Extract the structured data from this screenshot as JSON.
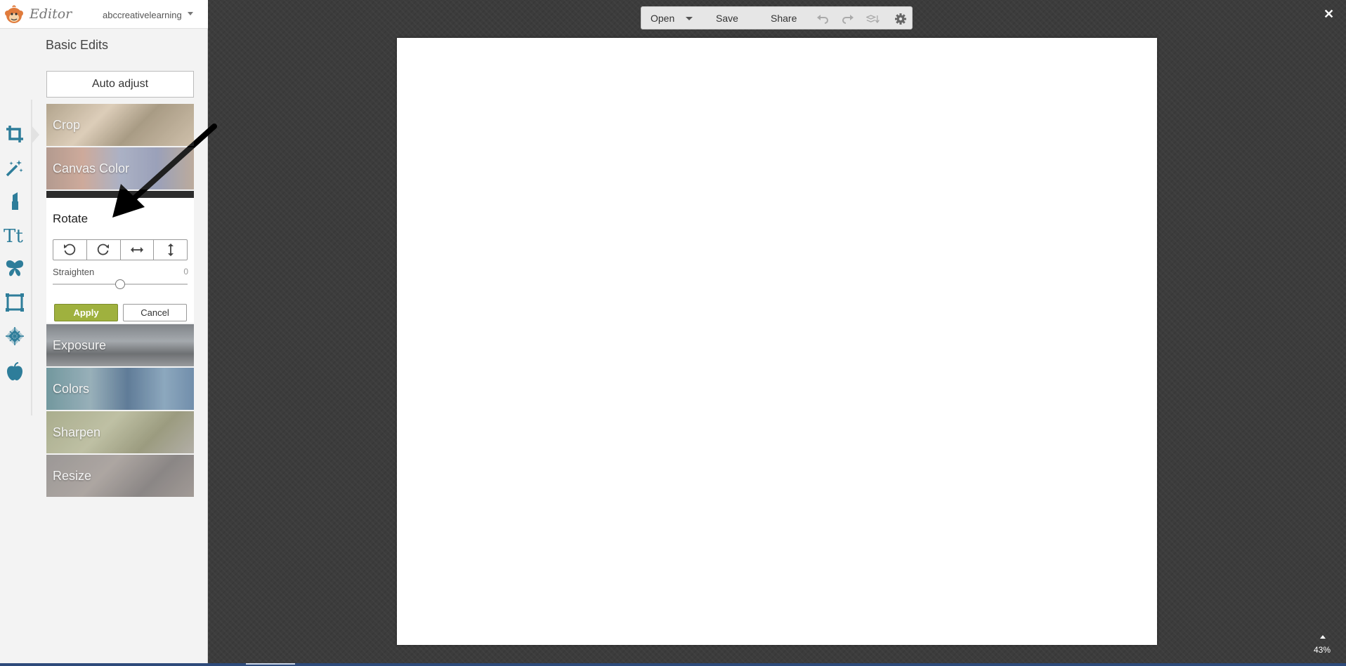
{
  "app": {
    "logo_text": "Editor",
    "account_name": "abccreativelearning"
  },
  "panel": {
    "title": "Basic Edits",
    "auto_adjust_label": "Auto adjust",
    "tiles": {
      "crop": "Crop",
      "canvas_color": "Canvas Color",
      "exposure": "Exposure",
      "colors": "Colors",
      "sharpen": "Sharpen",
      "resize": "Resize"
    },
    "rotate": {
      "title": "Rotate",
      "straighten_label": "Straighten",
      "straighten_value": "0",
      "straighten_fraction": 0.5,
      "apply_label": "Apply",
      "cancel_label": "Cancel"
    }
  },
  "tool_rail": [
    {
      "icon": "crop-icon",
      "active": true
    },
    {
      "icon": "magic-wand-icon"
    },
    {
      "icon": "lipstick-icon"
    },
    {
      "icon": "text-icon",
      "text": "Tt"
    },
    {
      "icon": "butterfly-icon"
    },
    {
      "icon": "frame-icon"
    },
    {
      "icon": "texture-icon"
    },
    {
      "icon": "apple-icon"
    }
  ],
  "toolbar": {
    "open_label": "Open",
    "save_label": "Save",
    "share_label": "Share"
  },
  "canvas": {
    "zoom": "43%"
  },
  "colors": {
    "active_tool": "#2e7d9a",
    "apply_button": "#9fb13e",
    "workspace": "#3c3c3c"
  }
}
